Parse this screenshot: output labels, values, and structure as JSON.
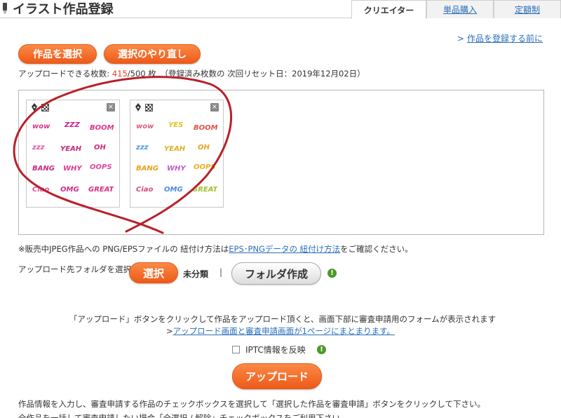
{
  "header": {
    "title": "イラスト作品登録",
    "tabs": [
      {
        "label": "クリエイター",
        "active": true
      },
      {
        "label": "単品購入",
        "active": false
      },
      {
        "label": "定額制",
        "active": false
      }
    ]
  },
  "links": {
    "before_register": "作品を登録する前に",
    "before_register_arrow": ">"
  },
  "buttons": {
    "select_work": "作品を選択",
    "reselect": "選択のやり直し",
    "select_folder": "選択",
    "create_folder": "フォルダ作成",
    "upload": "アップロード"
  },
  "upload_count": {
    "prefix": "アップロードできる枚数: ",
    "used": "415",
    "total": "/500 枚",
    "reset_note": "（登録済み枚数の 次回リセット日：2019年12月02日）"
  },
  "thumbnails": [
    {
      "name": "pink-comic-words",
      "close": "×"
    },
    {
      "name": "colorful-comic-words",
      "close": "×"
    }
  ],
  "note": {
    "prefix": "※販売中JPEG作品への PNG/EPSファイルの 紐付け方法は",
    "link": "EPS･PNGデータの 紐付け方法",
    "suffix": "をご確認ください。"
  },
  "folder": {
    "label": "アップロード先フォルダを選択",
    "current": "未分類",
    "separator": "|"
  },
  "info_icon": "!",
  "instruction": {
    "text": "「アップロード」ボタンをクリックして作品をアップロード頂くと、画面下部に審査申請用のフォームが表示されます",
    "link_prefix": ">",
    "link": "アップロード画面と審査申請画面が1ページにまとまります。"
  },
  "iptc": {
    "label": "IPTC情報を反映",
    "checked": false
  },
  "bottom": {
    "line1": "作品情報を入力し、審査申請する作品のチェックボックスを選択して「選択した作品を審査申請」ボタンをクリックして下さい。",
    "line2": "全作品を一括して審査申請したい場合「全選択 / 解除」チェックボックスをご利用下さい。"
  },
  "colors": {
    "accent_orange": "#ee5a1a",
    "link_blue": "#2a6ebb",
    "annotation_red": "#b8202a",
    "info_green": "#4a9a2a"
  }
}
